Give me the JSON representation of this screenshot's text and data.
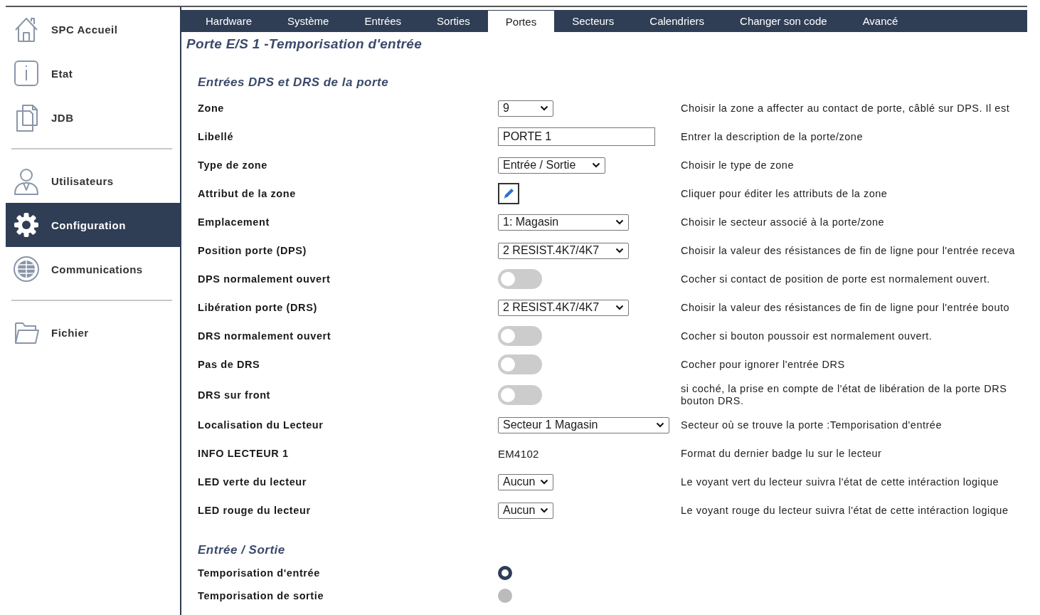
{
  "sidebar": {
    "groups": [
      {
        "items": [
          {
            "label": "SPC Accueil",
            "selected": false
          },
          {
            "label": "Etat",
            "selected": false
          },
          {
            "label": "JDB",
            "selected": false
          }
        ]
      },
      {
        "items": [
          {
            "label": "Utilisateurs",
            "selected": false
          },
          {
            "label": "Configuration",
            "selected": true
          },
          {
            "label": "Communications",
            "selected": false
          }
        ]
      },
      {
        "items": [
          {
            "label": "Fichier",
            "selected": false
          }
        ]
      }
    ]
  },
  "tabs": [
    {
      "label": "Hardware",
      "selected": false
    },
    {
      "label": "Système",
      "selected": false
    },
    {
      "label": "Entrées",
      "selected": false
    },
    {
      "label": "Sorties",
      "selected": false
    },
    {
      "label": "Portes",
      "selected": true
    },
    {
      "label": "Secteurs",
      "selected": false
    },
    {
      "label": "Calendriers",
      "selected": false
    },
    {
      "label": "Changer son code",
      "selected": false
    },
    {
      "label": "Avancé",
      "selected": false
    }
  ],
  "page_title": "Porte E/S 1 -Temporisation d'entrée",
  "sections": [
    {
      "heading": "Entrées DPS et DRS de la porte",
      "rows": [
        {
          "label": "Zone",
          "kind": "select",
          "value": "9",
          "description": "Choisir la zone a affecter au contact de porte, câblé sur DPS. Il est"
        },
        {
          "label": "Libellé",
          "kind": "text",
          "value": "PORTE 1",
          "description": "Entrer la description de la porte/zone"
        },
        {
          "label": "Type de zone",
          "kind": "select",
          "value": "Entrée / Sortie",
          "description": "Choisir le type de zone"
        },
        {
          "label": "Attribut de la zone",
          "kind": "edit",
          "description": "Cliquer pour éditer les attributs de la zone"
        },
        {
          "label": "Emplacement",
          "kind": "select",
          "value": "1: Magasin",
          "description": "Choisir le secteur associé à la porte/zone"
        },
        {
          "label": "Position porte (DPS)",
          "kind": "select",
          "value": "2 RESIST.4K7/4K7",
          "description": "Choisir la valeur des résistances de fin de ligne pour l'entrée receva"
        },
        {
          "label": "DPS normalement ouvert",
          "kind": "toggle",
          "on": false,
          "description": "Cocher si contact de position de porte est normalement ouvert."
        },
        {
          "label": "Libération porte (DRS)",
          "kind": "select",
          "value": "2 RESIST.4K7/4K7",
          "description": "Choisir la valeur des résistances de fin de ligne pour l'entrée bouto"
        },
        {
          "label": "DRS normalement ouvert",
          "kind": "toggle",
          "on": false,
          "description": "Cocher si bouton poussoir est normalement ouvert."
        },
        {
          "label": "Pas de DRS",
          "kind": "toggle",
          "on": false,
          "description": "Cocher pour ignorer l'entrée DRS"
        },
        {
          "label": "DRS sur front",
          "kind": "toggle",
          "on": false,
          "description": "si coché, la prise en compte de l'état de libération de la porte DRS\nbouton DRS."
        },
        {
          "label": "Localisation du Lecteur",
          "kind": "select",
          "value": "Secteur 1 Magasin",
          "description": "Secteur où se trouve la porte :Temporisation d'entrée"
        },
        {
          "label": "INFO LECTEUR 1",
          "kind": "static",
          "value": "EM4102",
          "description": "Format du dernier badge lu sur le lecteur"
        },
        {
          "label": "LED verte du lecteur",
          "kind": "select",
          "value": "Aucun",
          "description": "Le voyant vert du lecteur suivra l'état de cette intéraction logique"
        },
        {
          "label": "LED rouge du lecteur",
          "kind": "select",
          "value": "Aucun",
          "description": "Le voyant rouge du lecteur suivra l'état de cette intéraction logique"
        }
      ]
    },
    {
      "heading": "Entrée / Sortie",
      "rows": [
        {
          "label": "Temporisation d'entrée",
          "kind": "radio",
          "selected": true
        },
        {
          "label": "Temporisation de sortie",
          "kind": "radio",
          "selected": false
        }
      ]
    }
  ]
}
